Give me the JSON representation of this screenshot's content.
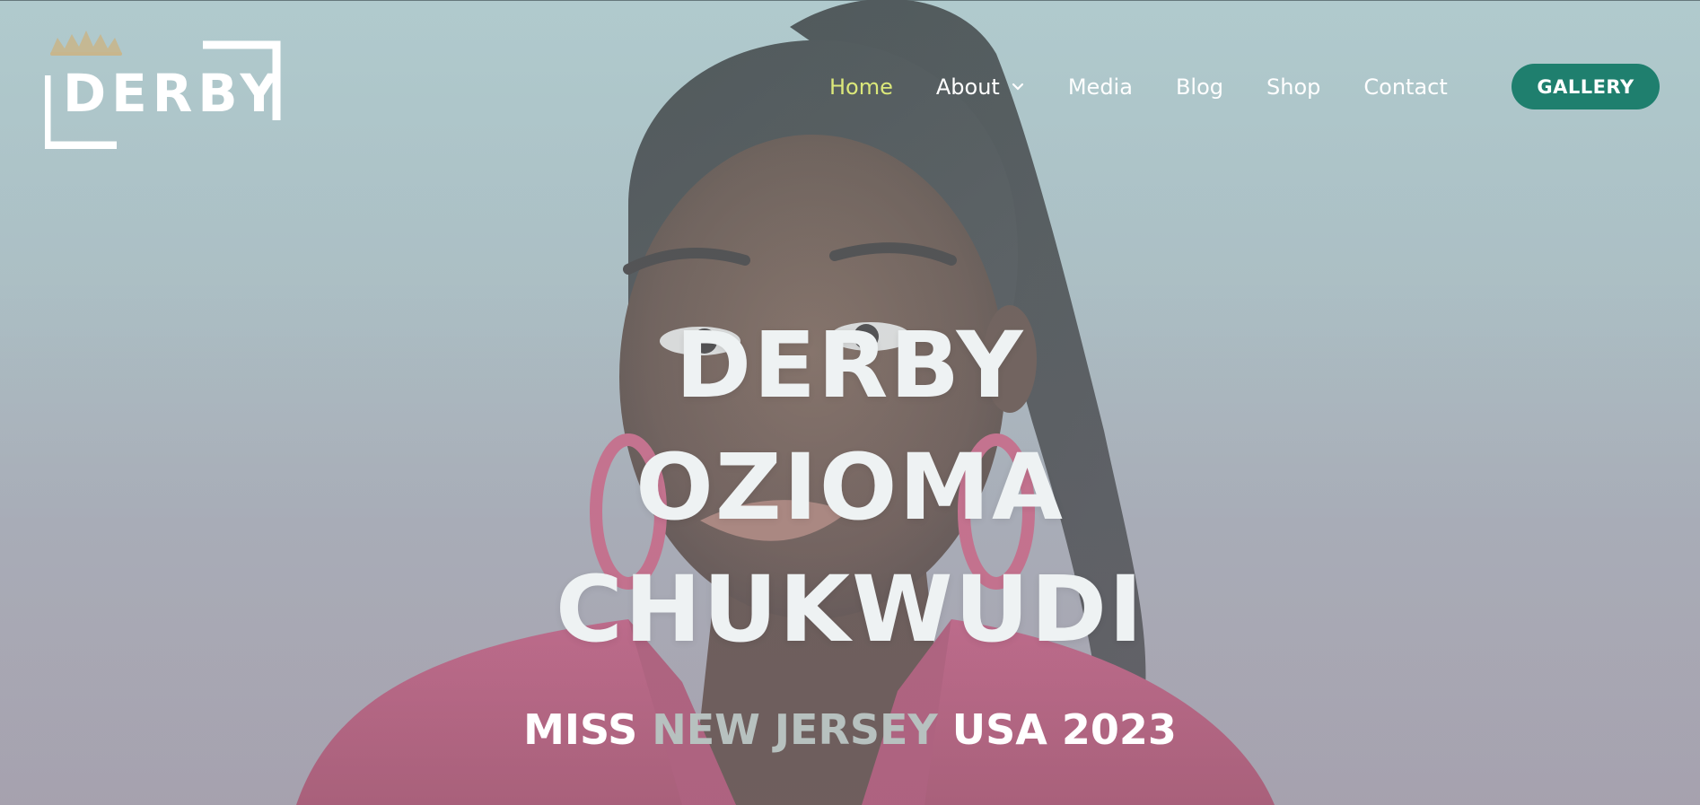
{
  "logo": {
    "text": "DERBY",
    "icon": "crown-icon"
  },
  "nav": {
    "items": [
      {
        "label": "Home",
        "active": true
      },
      {
        "label": "About",
        "dropdown": true
      },
      {
        "label": "Media"
      },
      {
        "label": "Blog"
      },
      {
        "label": "Shop"
      },
      {
        "label": "Contact"
      }
    ],
    "cta_label": "GALLERY"
  },
  "hero": {
    "title_lines": [
      "DERBY",
      "OZIOMA",
      "CHUKWUDI"
    ],
    "subtitle": {
      "part1": "MISS ",
      "accent": "NEW JERSEY",
      "part2": " USA 2023"
    }
  },
  "colors": {
    "active_nav": "#dbe87a",
    "cta_background": "#1f7f6e",
    "title": "#eef2f3",
    "subtitle_accent": "#b7c1bf",
    "jacket": "#c73566"
  }
}
